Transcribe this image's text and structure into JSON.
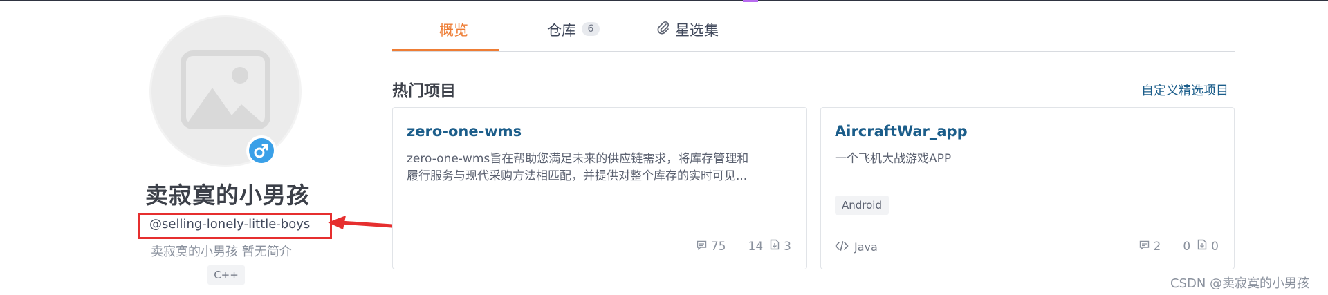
{
  "profile": {
    "username": "卖寂寞的小男孩",
    "handle": "@selling-lonely-little-boys",
    "bio": "卖寂寞的小男孩 暂无简介",
    "language_tag": "C++"
  },
  "tabs": [
    {
      "label": "概览",
      "active": true
    },
    {
      "label": "仓库",
      "count": "6"
    },
    {
      "label": "星选集"
    }
  ],
  "section": {
    "title": "热门项目",
    "customize_link": "自定义精选项目"
  },
  "cards": [
    {
      "title": "zero-one-wms",
      "description_line1": "zero-one-wms旨在帮助您满足未来的供应链需求，将库存管理和",
      "description_line2": "履行服务与现代采购方法相匹配，并提供对整个库存的实时可见...",
      "comments": "75",
      "stars": "14",
      "forks": "3"
    },
    {
      "title": "AircraftWar_app",
      "description_line1": "一个飞机大战游戏APP",
      "tag": "Android",
      "language": "Java",
      "comments": "2",
      "stars": "0",
      "forks": "0"
    }
  ],
  "watermark": "CSDN @卖寂寞的小男孩",
  "colors": {
    "accent": "#ee7d35",
    "link": "#1b5d8a",
    "annotation": "#e62f2f",
    "gender_badge": "#3aa0e8"
  },
  "icons": [
    "image-placeholder-icon",
    "male-gender-icon",
    "paperclip-icon",
    "comment-icon",
    "star-icon",
    "fork-icon",
    "code-icon"
  ]
}
